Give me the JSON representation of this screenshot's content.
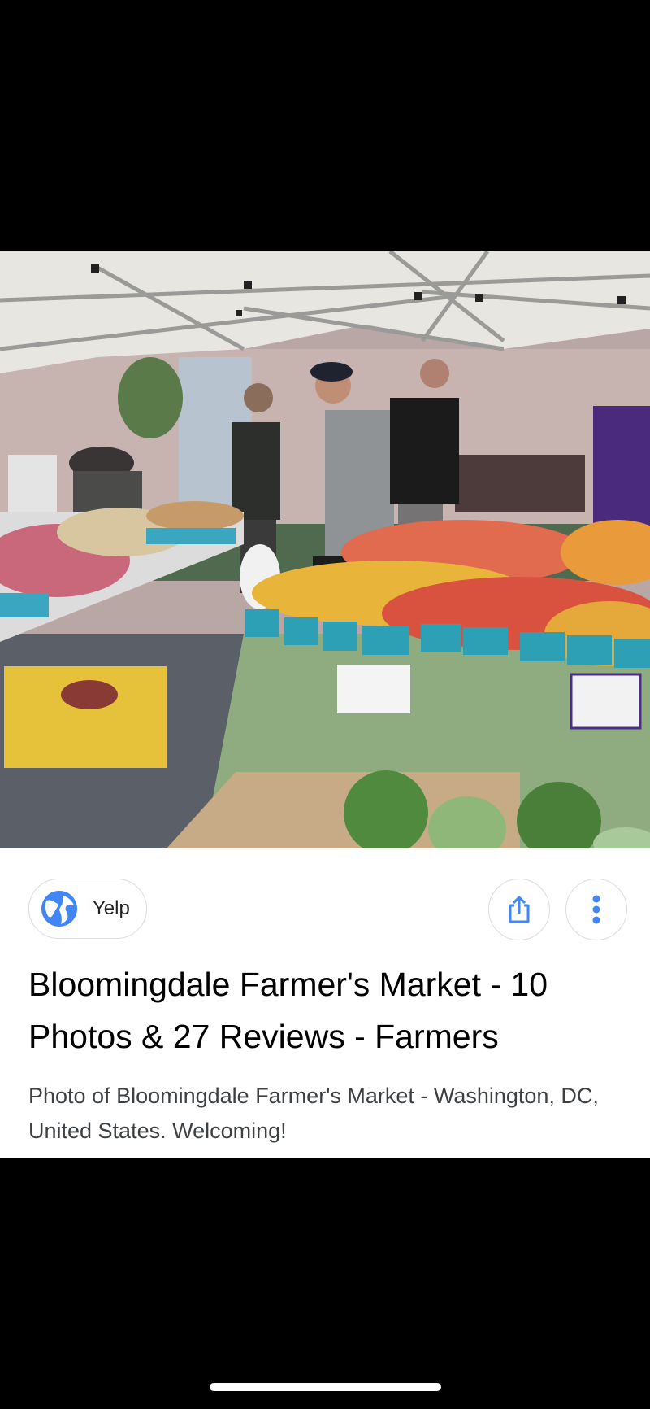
{
  "image_viewer": {
    "photo_alt": "Farmers market stand with tomatoes, sweet potatoes and watermelons under a white tent"
  },
  "source": {
    "label": "Yelp",
    "icon": "globe-icon",
    "icon_color": "#4285f4"
  },
  "actions": {
    "share_icon": "share-icon",
    "more_icon": "more-vert-icon",
    "accent_color": "#4285f4"
  },
  "result": {
    "title": "Bloomingdale Farmer's Market - 10 Photos & 27 Reviews - Farmers",
    "description": "Photo of Bloomingdale Farmer's Market - Washington, DC, United States. Welcoming!"
  }
}
